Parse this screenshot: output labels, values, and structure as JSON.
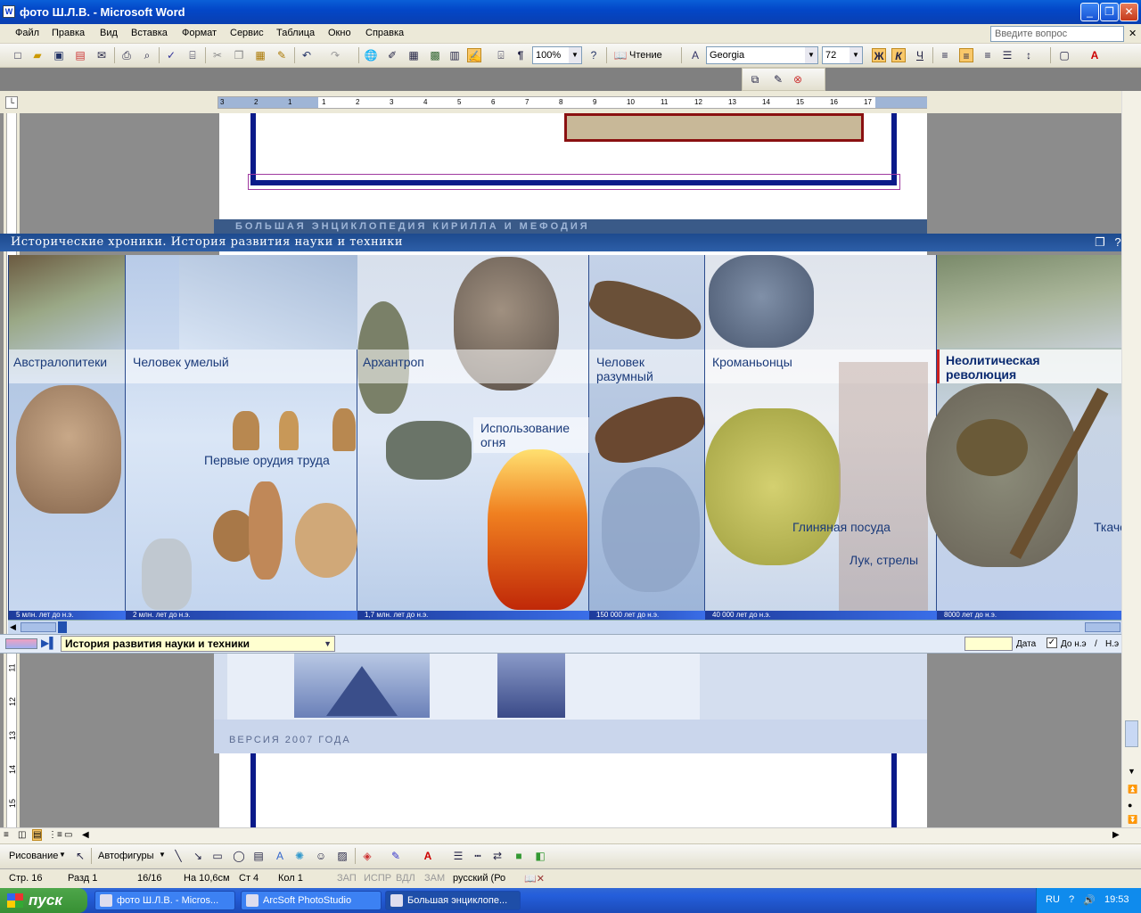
{
  "window": {
    "title": "фото Ш.Л.В. - Microsoft Word",
    "icon_letter": "W"
  },
  "menu": [
    "Файл",
    "Правка",
    "Вид",
    "Вставка",
    "Формат",
    "Сервис",
    "Таблица",
    "Окно",
    "Справка"
  ],
  "help_box": {
    "placeholder": "Введите вопрос"
  },
  "toolbar": {
    "zoom": "100%",
    "reading_label": "Чтение",
    "font": "Georgia",
    "font_size": "72",
    "bold": "Ж",
    "italic": "К",
    "underline": "Ч",
    "pilcrow": "¶"
  },
  "ruler": {
    "ticks": [
      "3",
      "2",
      "1",
      "1",
      "2",
      "3",
      "4",
      "5",
      "6",
      "7",
      "8",
      "9",
      "10",
      "11",
      "12",
      "13",
      "14",
      "15",
      "16",
      "17"
    ]
  },
  "vruler": {
    "ticks": [
      "11",
      "12",
      "13",
      "14",
      "15"
    ]
  },
  "encyclopedia": {
    "back_title": "БОЛЬШАЯ ЭНЦИКЛОПЕДИЯ КИРИЛЛА И МЕФОДИЯ",
    "title": "Исторические хроники. История развития науки и техники",
    "columns": [
      {
        "label": "Австралопитеки",
        "date": "5  млн. лет до н.э."
      },
      {
        "label": "Человек  умелый",
        "date": "2  млн. лет до н.э."
      },
      {
        "label": "Архантроп",
        "date": "1,7  млн. лет до н.э."
      },
      {
        "label": "Человек разумный",
        "date": "150 000  лет до н.э."
      },
      {
        "label": "Кроманьонцы",
        "date": "40 000  лет до н.э."
      },
      {
        "label": "Неолитическая революция",
        "date": "8000  лет до н.э."
      }
    ],
    "events": {
      "tools": "Первые орудия труда",
      "fire": "Использование огня",
      "pottery": "Глиняная  посуда",
      "bow": "Лук, стрелы",
      "weaving": "Ткачес"
    },
    "selector": "История развития науки и техники",
    "date_label": "Дата",
    "before_label": "До н.э",
    "after_label": "Н.э",
    "version": "ВЕРСИЯ 2007 ГОДА"
  },
  "drawing": {
    "draw_label": "Рисование",
    "autoshapes_label": "Автофигуры"
  },
  "status": {
    "page": "Стр.  16",
    "section": "Разд  1",
    "pages": "16/16",
    "at": "На  10,6см",
    "line": "Ст  4",
    "col": "Кол  1",
    "rec": "ЗАП",
    "trk": "ИСПР",
    "ext": "ВДЛ",
    "ovr": "ЗАМ",
    "lang": "русский (Ро"
  },
  "taskbar": {
    "start": "пуск",
    "tasks": [
      "фото Ш.Л.В. - Micros...",
      "ArcSoft PhotoStudio",
      "Большая энциклопе..."
    ],
    "lang": "RU",
    "clock": "19:53"
  },
  "colors": {
    "accent": "#2d5fa8",
    "title_blue": "#0347c8",
    "neolithic_marker": "#cc2020"
  }
}
